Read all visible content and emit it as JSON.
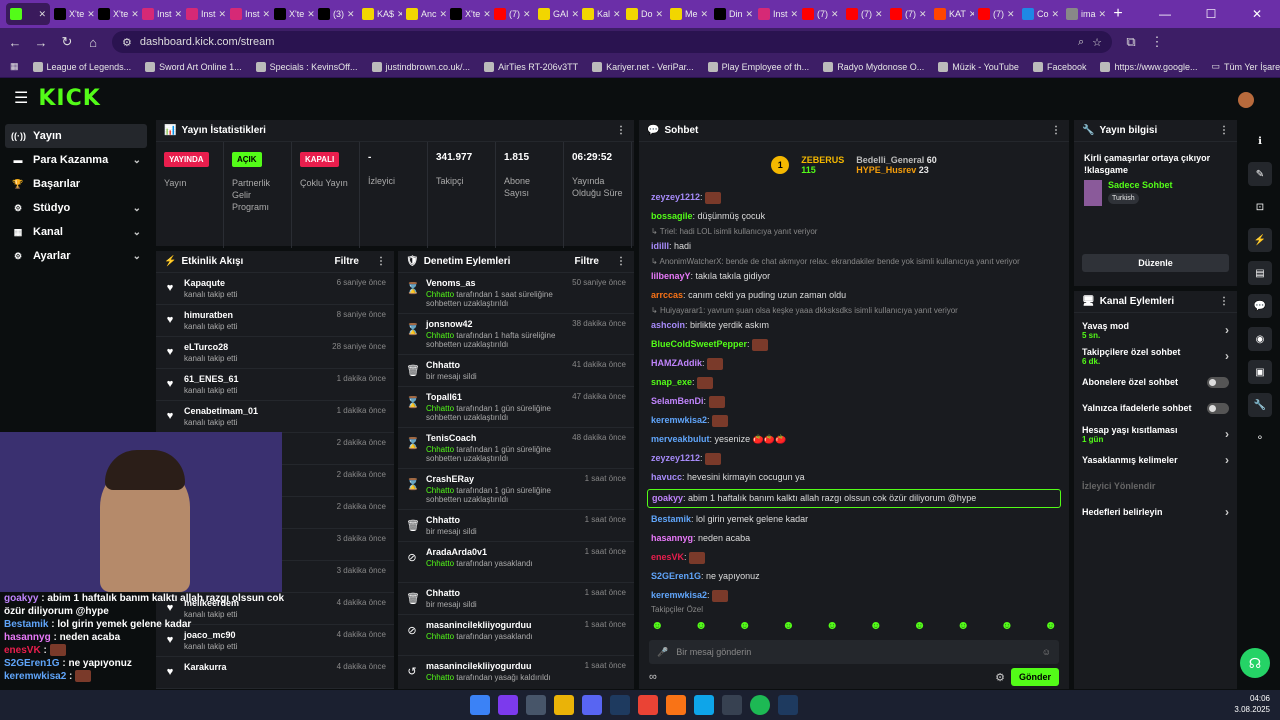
{
  "browser": {
    "tabs": [
      {
        "label": "",
        "color": "#53fc18",
        "active": true
      },
      {
        "label": "X'te",
        "color": "#000000"
      },
      {
        "label": "X'te",
        "color": "#000000"
      },
      {
        "label": "Inst",
        "color": "#d62976"
      },
      {
        "label": "Inst",
        "color": "#d62976"
      },
      {
        "label": "Inst",
        "color": "#d62976"
      },
      {
        "label": "X'te",
        "color": "#000000"
      },
      {
        "label": "(3)",
        "color": "#000000"
      },
      {
        "label": "KA$",
        "color": "#f2d600"
      },
      {
        "label": "Anc",
        "color": "#f2d600"
      },
      {
        "label": "X'te",
        "color": "#000000"
      },
      {
        "label": "(7)",
        "color": "#ff0000"
      },
      {
        "label": "GAI",
        "color": "#f2d600"
      },
      {
        "label": "Kal",
        "color": "#f2d600"
      },
      {
        "label": "Do",
        "color": "#f2d600"
      },
      {
        "label": "Me",
        "color": "#f2d600"
      },
      {
        "label": "Din",
        "color": "#000000"
      },
      {
        "label": "Inst",
        "color": "#d62976"
      },
      {
        "label": "(7)",
        "color": "#ff0000"
      },
      {
        "label": "(7)",
        "color": "#ff0000"
      },
      {
        "label": "(7)",
        "color": "#ff0000"
      },
      {
        "label": "KAT",
        "color": "#ff4500"
      },
      {
        "label": "(7)",
        "color": "#ff0000"
      },
      {
        "label": "Co",
        "color": "#1e88e5"
      },
      {
        "label": "ima",
        "color": "#888888"
      }
    ],
    "url": "dashboard.kick.com/stream",
    "bookmarks": [
      "League of Legends...",
      "Sword Art Online 1...",
      "Specials : KevinsOff...",
      "justindbrown.co.uk/...",
      "AirTies RT-206v3TT",
      "Kariyer.net - VeriPar...",
      "Play Employee of th...",
      "Radyo Mydonose O...",
      "Müzik - YouTube",
      "Facebook",
      "https://www.google..."
    ],
    "all_bookmarks": "Tüm Yer İşaretleri"
  },
  "sidebar": {
    "items": [
      {
        "label": "Yayın",
        "icon": "broadcast-icon",
        "active": true
      },
      {
        "label": "Para Kazanma",
        "icon": "money-icon",
        "chev": true
      },
      {
        "label": "Başarılar",
        "icon": "trophy-icon"
      },
      {
        "label": "Stüdyo",
        "icon": "studio-icon",
        "chev": true
      },
      {
        "label": "Kanal",
        "icon": "channel-icon",
        "chev": true
      },
      {
        "label": "Ayarlar",
        "icon": "gear-icon",
        "chev": true
      }
    ]
  },
  "stats": {
    "title": "Yayın İstatistikleri",
    "items": [
      {
        "badge": "YAYINDA",
        "badge_color": "#e91e4d",
        "label": "Yayın"
      },
      {
        "badge": "AÇIK",
        "badge_color": "#53fc18",
        "label": "Partnerlik Gelir Programı"
      },
      {
        "badge": "KAPALI",
        "badge_color": "#e91e4d",
        "label": "Çoklu Yayın"
      },
      {
        "value": "-",
        "label": "İzleyici"
      },
      {
        "value": "341.977",
        "label": "Takipçi"
      },
      {
        "value": "1.815",
        "label": "Abone Sayısı"
      },
      {
        "value": "06:29:52",
        "label": "Yayında Olduğu Süre"
      }
    ]
  },
  "activity": {
    "title": "Etkinlik Akışı",
    "filter": "Filtre",
    "items": [
      {
        "name": "Kapaqute",
        "sub": "kanalı takip etti",
        "time": "6 saniye önce"
      },
      {
        "name": "himuratben",
        "sub": "kanalı takip etti",
        "time": "8 saniye önce"
      },
      {
        "name": "eLTurco28",
        "sub": "kanalı takip etti",
        "time": "28 saniye önce"
      },
      {
        "name": "61_ENES_61",
        "sub": "kanalı takip etti",
        "time": "1 dakika önce"
      },
      {
        "name": "Cenabetimam_01",
        "sub": "kanalı takip etti",
        "time": "1 dakika önce"
      },
      {
        "name": "",
        "sub": "",
        "time": "2 dakika önce"
      },
      {
        "name": "",
        "sub": "",
        "time": "2 dakika önce"
      },
      {
        "name": "",
        "sub": "",
        "time": "2 dakika önce"
      },
      {
        "name": "",
        "sub": "",
        "time": "3 dakika önce"
      },
      {
        "name": "",
        "sub": "",
        "time": "3 dakika önce"
      },
      {
        "name": "melikeerdem",
        "sub": "kanalı takip etti",
        "time": "4 dakika önce"
      },
      {
        "name": "joaco_mc90",
        "sub": "kanalı takip etti",
        "time": "4 dakika önce"
      },
      {
        "name": "Karakurra",
        "sub": "",
        "time": "4 dakika önce"
      }
    ]
  },
  "moderation": {
    "title": "Denetim Eylemleri",
    "filter": "Filtre",
    "items": [
      {
        "icon": "⌛",
        "name": "Venoms_as",
        "mod": "Chhatto",
        "text": "tarafından 1 saat süreliğine sohbetten uzaklaştırıldı",
        "time": "50 saniye önce"
      },
      {
        "icon": "⌛",
        "name": "jonsnow42",
        "mod": "Chhatto",
        "text": "tarafından 1 hafta süreliğine sohbetten uzaklaştırıldı",
        "time": "38 dakika önce"
      },
      {
        "icon": "🗑",
        "name": "Chhatto",
        "mod": "",
        "text": "bir mesajı sildi",
        "time": "41 dakika önce"
      },
      {
        "icon": "⌛",
        "name": "Topall61",
        "mod": "Chhatto",
        "text": "tarafından 1 gün süreliğine sohbetten uzaklaştırıldı",
        "time": "47 dakika önce"
      },
      {
        "icon": "⌛",
        "name": "TenisCoach",
        "mod": "Chhatto",
        "text": "tarafından 1 gün süreliğine sohbetten uzaklaştırıldı",
        "time": "48 dakika önce"
      },
      {
        "icon": "⌛",
        "name": "CrashERay",
        "mod": "Chhatto",
        "text": "tarafından 1 gün süreliğine sohbetten uzaklaştırıldı",
        "time": "1 saat önce"
      },
      {
        "icon": "🗑",
        "name": "Chhatto",
        "mod": "",
        "text": "bir mesajı sildi",
        "time": "1 saat önce"
      },
      {
        "icon": "⊘",
        "name": "AradaArda0v1",
        "mod": "Chhatto",
        "text": "tarafından yasaklandı",
        "time": "1 saat önce"
      },
      {
        "icon": "🗑",
        "name": "Chhatto",
        "mod": "",
        "text": "bir mesajı sildi",
        "time": "1 saat önce"
      },
      {
        "icon": "⊘",
        "name": "masanincilekliiyogurduu",
        "mod": "Chhatto",
        "text": "tarafından yasaklandı",
        "time": "1 saat önce"
      },
      {
        "icon": "↺",
        "name": "masanincilekliiyogurduu",
        "mod": "Chhatto",
        "text": "tarafından yasağı kaldırıldı",
        "time": "1 saat önce"
      }
    ]
  },
  "chat": {
    "title": "Sohbet",
    "top": {
      "name": "ZEBERUS",
      "value": "115",
      "rank": "1"
    },
    "leaders": [
      {
        "name": "Bedelli_General",
        "value": "60"
      },
      {
        "name": "HYPE_Husrev",
        "value": "23"
      }
    ],
    "messages": [
      {
        "user": "zeyzey1212",
        "color": "#a78bfa",
        "text": "",
        "emote": true
      },
      {
        "user": "bossagile",
        "color": "#53fc18",
        "text": "düşünmüş çocuk"
      },
      {
        "reply": "Triel: hadi LOL isimli kullanıcıya yanıt veriyor"
      },
      {
        "user": "idilll",
        "color": "#a78bfa",
        "text": "hadi"
      },
      {
        "reply": "AnonimWatcherX: bende de chat akmıyor relax. ekrandakiler bende yok isimli kullanıcıya yanıt veriyor"
      },
      {
        "user": "lilbenayY",
        "color": "#e879f9",
        "text": "takıla takıla gidiyor"
      },
      {
        "user": "arrccas",
        "color": "#f97316",
        "text": "canım cekti ya puding uzun zaman oldu"
      },
      {
        "reply": "Huiyayarar1: yavrum şuan olsa keşke yaaa dkksksdks isimli kullanıcıya yanıt veriyor"
      },
      {
        "user": "ashcoin",
        "color": "#a78bfa",
        "text": "birlikte yerdik askım"
      },
      {
        "user": "BlueColdSweetPepper",
        "color": "#53fc18",
        "text": "",
        "emote": true
      },
      {
        "user": "HAMZAddik",
        "color": "#c084fc",
        "text": "",
        "emote": true
      },
      {
        "user": "snap_exe",
        "color": "#53fc18",
        "text": "",
        "emote": true
      },
      {
        "user": "SelamBenDi",
        "color": "#c084fc",
        "text": "",
        "emote": true
      },
      {
        "user": "keremwkisa2",
        "color": "#60a5fa",
        "text": "",
        "emote": true
      },
      {
        "user": "merveakbulut",
        "color": "#60a5fa",
        "text": "yesenize 🍅🍅🍅"
      },
      {
        "user": "zeyzey1212",
        "color": "#a78bfa",
        "text": "",
        "emote": true
      },
      {
        "user": "havucc",
        "color": "#a78bfa",
        "text": "hevesini kirmayin cocugun ya"
      },
      {
        "user": "goakyy",
        "color": "#c084fc",
        "text": "abim 1 haftalık banım kalktı allah razgı olssun cok özür diliyorum @hype",
        "highlight": true
      },
      {
        "user": "Bestamik",
        "color": "#60a5fa",
        "text": "lol girin yemek gelene kadar"
      },
      {
        "user": "hasannyg",
        "color": "#e879f9",
        "text": "neden acaba"
      },
      {
        "user": "enesVK",
        "color": "#e91e4d",
        "text": "",
        "emote": true
      },
      {
        "user": "S2GEren1G",
        "color": "#60a5fa",
        "text": "ne yapıyonuz"
      },
      {
        "user": "keremwkisa2",
        "color": "#60a5fa",
        "text": "",
        "emote": true
      }
    ],
    "follower_only": "Takipçiler Özel",
    "placeholder": "Bir mesaj gönderin",
    "send": "Gönder"
  },
  "stream_info": {
    "title": "Yayın bilgisi",
    "stream_title": "Kirli çamaşırlar ortaya çıkıyor !klasgame",
    "category": "Sadece Sohbet",
    "tag": "Turkish",
    "edit": "Düzenle"
  },
  "channel_actions": {
    "title": "Kanal Eylemleri",
    "rows": [
      {
        "label": "Yavaş mod",
        "sub": "5 sn.",
        "type": "arrow"
      },
      {
        "label": "Takipçilere özel sohbet",
        "sub": "6 dk.",
        "type": "arrow"
      },
      {
        "label": "Abonelere özel sohbet",
        "sub": "",
        "type": "toggle"
      },
      {
        "label": "Yalnızca ifadelerle sohbet",
        "sub": "",
        "type": "toggle"
      },
      {
        "label": "Hesap yaşı kısıtlaması",
        "sub": "1 gün",
        "type": "arrow"
      },
      {
        "label": "Yasaklanmış kelimeler",
        "sub": "",
        "type": "arrow"
      },
      {
        "label": "İzleyici Yönlendir",
        "sub": "",
        "type": "disabled"
      },
      {
        "label": "Hedefleri belirleyin",
        "sub": "",
        "type": "arrow"
      }
    ]
  },
  "overlay": {
    "lines": [
      {
        "user": "goakyy",
        "color": "#c084fc",
        "text": "abim 1 haftalık banım kalktı allah razgı olssun cok özür diliyorum @hype"
      },
      {
        "user": "Bestamik",
        "color": "#60a5fa",
        "text": "lol girin yemek gelene kadar"
      },
      {
        "user": "hasannyg",
        "color": "#e879f9",
        "text": "neden acaba"
      },
      {
        "user": "enesVK",
        "color": "#e91e4d",
        "text": ""
      },
      {
        "user": "S2GEren1G",
        "color": "#60a5fa",
        "text": "ne yapıyonuz"
      },
      {
        "user": "keremwkisa2",
        "color": "#60a5fa",
        "text": ""
      }
    ]
  },
  "taskbar": {
    "time": "04:06",
    "date": "3.08.2025"
  }
}
